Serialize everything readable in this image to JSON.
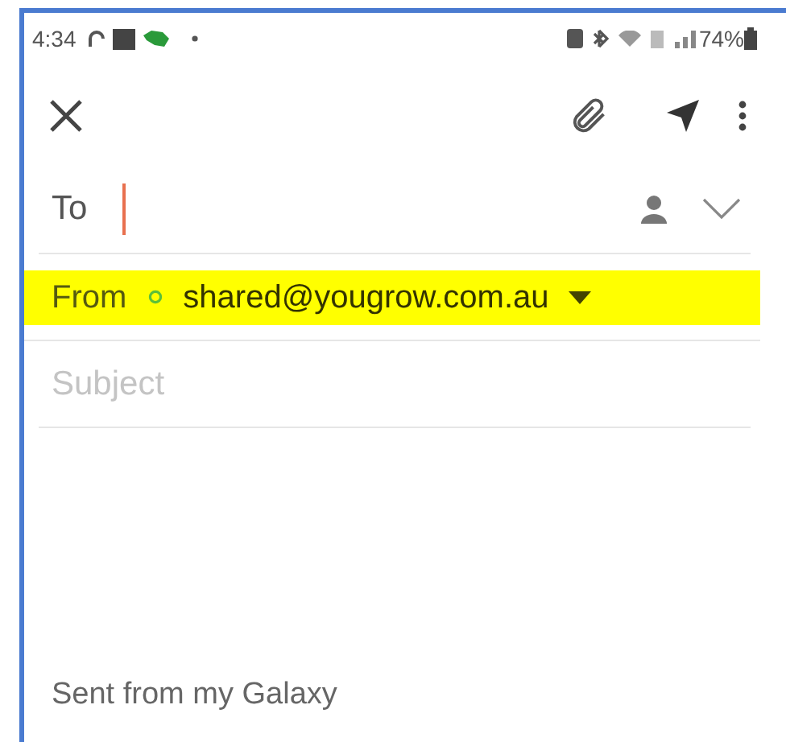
{
  "status_bar": {
    "time": "4:34",
    "battery": "74%"
  },
  "to": {
    "label": "To"
  },
  "from": {
    "label": "From",
    "account": "shared@yougrow.com.au",
    "highlighted": true
  },
  "subject": {
    "placeholder": "Subject"
  },
  "signature": "Sent from my Galaxy"
}
